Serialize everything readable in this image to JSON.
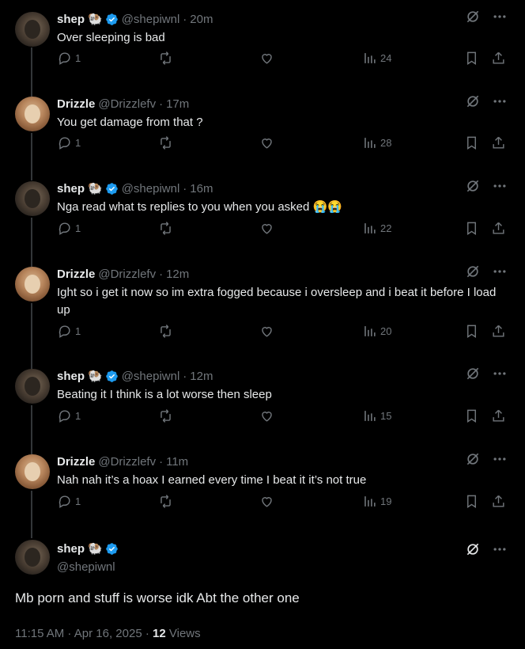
{
  "users": {
    "shep": {
      "name": "shep",
      "emoji": "🐏",
      "handle": "@shepiwnl"
    },
    "drizzle": {
      "name": "Drizzle",
      "handle": "@Drizzlefv"
    }
  },
  "replies": [
    {
      "name": "shep",
      "emoji": "🐏",
      "handle": "@shepiwnl",
      "time": "20m",
      "text": "Over sleeping is bad",
      "replies": "1",
      "views": "24"
    },
    {
      "name": "Drizzle",
      "handle": "@Drizzlefv",
      "time": "17m",
      "text": "You get damage from that ?",
      "replies": "1",
      "views": "28"
    },
    {
      "name": "shep",
      "emoji": "🐏",
      "handle": "@shepiwnl",
      "time": "16m",
      "text": "Nga read what ts replies to you when you asked 😭😭",
      "replies": "1",
      "views": "22"
    },
    {
      "name": "Drizzle",
      "handle": "@Drizzlefv",
      "time": "12m",
      "text": "Ight so i get it now so im extra fogged because i oversleep and i beat it before I load up",
      "replies": "1",
      "views": "20"
    },
    {
      "name": "shep",
      "emoji": "🐏",
      "handle": "@shepiwnl",
      "time": "12m",
      "text": "Beating it I think is a lot worse then sleep",
      "replies": "1",
      "views": "15"
    },
    {
      "name": "Drizzle",
      "handle": "@Drizzlefv",
      "time": "11m",
      "text": "Nah nah it’s a hoax I earned every time I beat it it’s not true",
      "replies": "1",
      "views": "19"
    }
  ],
  "main": {
    "name": "shep",
    "emoji": "🐏",
    "handle": "@shepiwnl",
    "text": "Mb porn and stuff is worse idk Abt the other one",
    "timestamp": "11:15 AM · Apr 16, 2025",
    "separator": " · ",
    "views_count": "12",
    "views_label": "Views"
  },
  "colors": {
    "background": "#000000",
    "text": "#e7e9ea",
    "muted": "#71767b",
    "verified": "#1d9bf0",
    "line": "#333639"
  },
  "icons": [
    "reply-icon",
    "retweet-icon",
    "like-icon",
    "views-icon",
    "bookmark-icon",
    "share-icon",
    "grok-icon",
    "more-icon",
    "verified-badge-icon"
  ]
}
